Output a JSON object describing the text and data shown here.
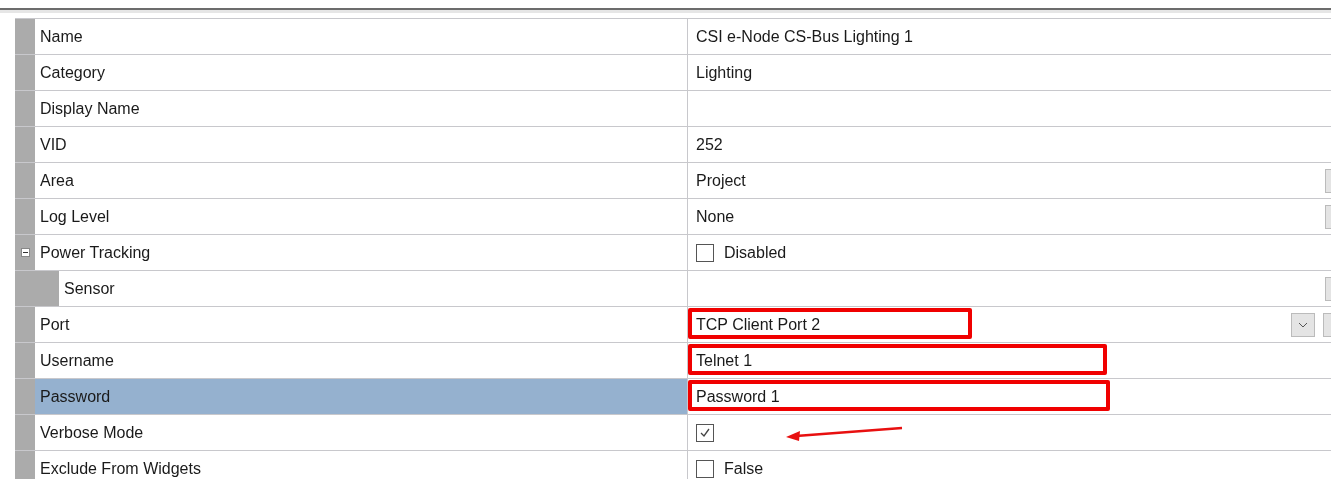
{
  "properties": [
    {
      "label": "Name",
      "kind": "text",
      "value": "CSI e-Node CS-Bus Lighting 1",
      "selected": false
    },
    {
      "label": "Category",
      "kind": "text",
      "value": "Lighting",
      "selected": false
    },
    {
      "label": "Display Name",
      "kind": "text",
      "selected": false
    },
    {
      "label": "VID",
      "kind": "text",
      "value": "252",
      "selected": false
    },
    {
      "label": "Area",
      "kind": "dropdown",
      "value": "Project",
      "selected": false
    },
    {
      "label": "Log Level",
      "kind": "dropdown",
      "value": "None",
      "selected": false
    },
    {
      "label": "Power Tracking",
      "kind": "checkbox",
      "checked": false,
      "value": "Disabled",
      "selected": false,
      "expanded": true,
      "children": [
        {
          "label": "Sensor",
          "kind": "dropdown",
          "selected": false
        }
      ]
    },
    {
      "label": "Port",
      "kind": "picker",
      "value": "TCP Client Port 2",
      "selected": false,
      "highlighted": true
    },
    {
      "label": "Username",
      "kind": "text",
      "value": "Telnet 1",
      "selected": false,
      "highlighted": true
    },
    {
      "label": "Password",
      "kind": "text",
      "value": "Password 1",
      "selected": true,
      "highlighted": true
    },
    {
      "label": "Verbose Mode",
      "kind": "checkbox",
      "checked": true,
      "selected": false,
      "arrow": true
    },
    {
      "label": "Exclude From Widgets",
      "kind": "checkbox",
      "checked": false,
      "value": "False",
      "selected": false
    }
  ]
}
